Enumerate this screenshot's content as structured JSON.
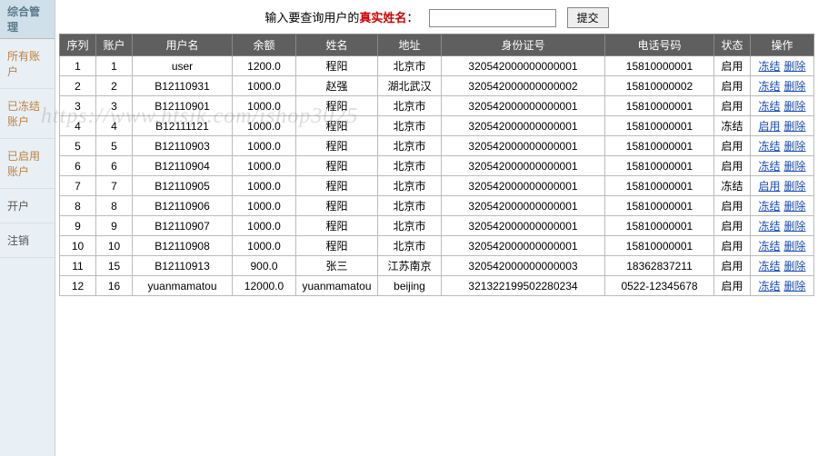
{
  "sidebar": {
    "header": "综合管理",
    "items": [
      {
        "label": "所有账户",
        "cls": ""
      },
      {
        "label": "已冻结账户",
        "cls": ""
      },
      {
        "label": "已启用账户",
        "cls": ""
      },
      {
        "label": "开户",
        "cls": "dark"
      },
      {
        "label": "注销",
        "cls": "dark"
      }
    ]
  },
  "search": {
    "label_prefix": "输入要查询用户的",
    "label_highlight": "真实姓名",
    "label_suffix": "：",
    "placeholder": "",
    "submit": "提交"
  },
  "table": {
    "headers": [
      "序列",
      "账户",
      "用户名",
      "余额",
      "姓名",
      "地址",
      "身份证号",
      "电话号码",
      "状态",
      "操作"
    ],
    "rows": [
      {
        "seq": "1",
        "acct": "1",
        "user": "user",
        "bal": "1200.0",
        "name": "程阳",
        "addr": "北京市",
        "id": "320542000000000001",
        "phone": "15810000001",
        "status": "启用",
        "ops": [
          "冻结",
          "删除"
        ]
      },
      {
        "seq": "2",
        "acct": "2",
        "user": "B12110931",
        "bal": "1000.0",
        "name": "赵强",
        "addr": "湖北武汉",
        "id": "320542000000000002",
        "phone": "15810000002",
        "status": "启用",
        "ops": [
          "冻结",
          "删除"
        ]
      },
      {
        "seq": "3",
        "acct": "3",
        "user": "B12110901",
        "bal": "1000.0",
        "name": "程阳",
        "addr": "北京市",
        "id": "320542000000000001",
        "phone": "15810000001",
        "status": "启用",
        "ops": [
          "冻结",
          "删除"
        ]
      },
      {
        "seq": "4",
        "acct": "4",
        "user": "B12111121",
        "bal": "1000.0",
        "name": "程阳",
        "addr": "北京市",
        "id": "320542000000000001",
        "phone": "15810000001",
        "status": "冻结",
        "ops": [
          "启用",
          "删除"
        ]
      },
      {
        "seq": "5",
        "acct": "5",
        "user": "B12110903",
        "bal": "1000.0",
        "name": "程阳",
        "addr": "北京市",
        "id": "320542000000000001",
        "phone": "15810000001",
        "status": "启用",
        "ops": [
          "冻结",
          "删除"
        ]
      },
      {
        "seq": "6",
        "acct": "6",
        "user": "B12110904",
        "bal": "1000.0",
        "name": "程阳",
        "addr": "北京市",
        "id": "320542000000000001",
        "phone": "15810000001",
        "status": "启用",
        "ops": [
          "冻结",
          "删除"
        ]
      },
      {
        "seq": "7",
        "acct": "7",
        "user": "B12110905",
        "bal": "1000.0",
        "name": "程阳",
        "addr": "北京市",
        "id": "320542000000000001",
        "phone": "15810000001",
        "status": "冻结",
        "ops": [
          "启用",
          "删除"
        ]
      },
      {
        "seq": "8",
        "acct": "8",
        "user": "B12110906",
        "bal": "1000.0",
        "name": "程阳",
        "addr": "北京市",
        "id": "320542000000000001",
        "phone": "15810000001",
        "status": "启用",
        "ops": [
          "冻结",
          "删除"
        ]
      },
      {
        "seq": "9",
        "acct": "9",
        "user": "B12110907",
        "bal": "1000.0",
        "name": "程阳",
        "addr": "北京市",
        "id": "320542000000000001",
        "phone": "15810000001",
        "status": "启用",
        "ops": [
          "冻结",
          "删除"
        ]
      },
      {
        "seq": "10",
        "acct": "10",
        "user": "B12110908",
        "bal": "1000.0",
        "name": "程阳",
        "addr": "北京市",
        "id": "320542000000000001",
        "phone": "15810000001",
        "status": "启用",
        "ops": [
          "冻结",
          "删除"
        ]
      },
      {
        "seq": "11",
        "acct": "15",
        "user": "B12110913",
        "bal": "900.0",
        "name": "张三",
        "addr": "江苏南京",
        "id": "320542000000000003",
        "phone": "18362837211",
        "status": "启用",
        "ops": [
          "冻结",
          "删除"
        ]
      },
      {
        "seq": "12",
        "acct": "16",
        "user": "yuanmamatou",
        "bal": "12000.0",
        "name": "yuanmamatou",
        "addr": "beijing",
        "id": "321322199502280234",
        "phone": "0522-12345678",
        "status": "启用",
        "ops": [
          "冻结",
          "删除"
        ]
      }
    ]
  },
  "watermark": "https://www.htsjk.com/ishop3025"
}
